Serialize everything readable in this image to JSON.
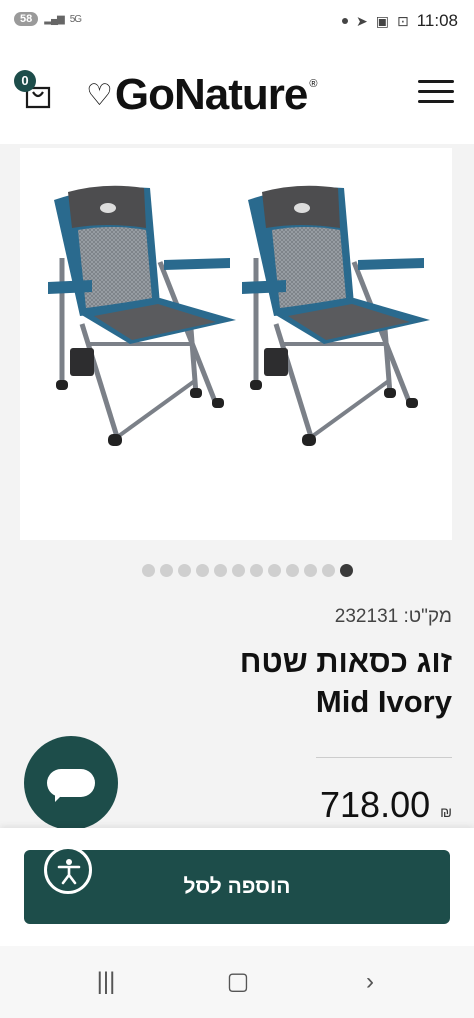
{
  "status_bar": {
    "notification_count": "58",
    "network": "5G",
    "time": "11:08"
  },
  "header": {
    "cart_count": "0",
    "brand": "GoNature",
    "brand_mark": "®"
  },
  "gallery": {
    "image_alt": "two camping chairs",
    "slide_count": 12,
    "active_slide": 12
  },
  "product": {
    "sku_label": "מק\"ט:",
    "sku": "232131",
    "title_line1": "זוג כסאות שטח",
    "title_line2": "Mid Ivory",
    "price": "718.00",
    "currency": "₪"
  },
  "actions": {
    "add_to_cart": "הוספה לסל"
  },
  "colors": {
    "brand_green": "#1d4d4a"
  }
}
